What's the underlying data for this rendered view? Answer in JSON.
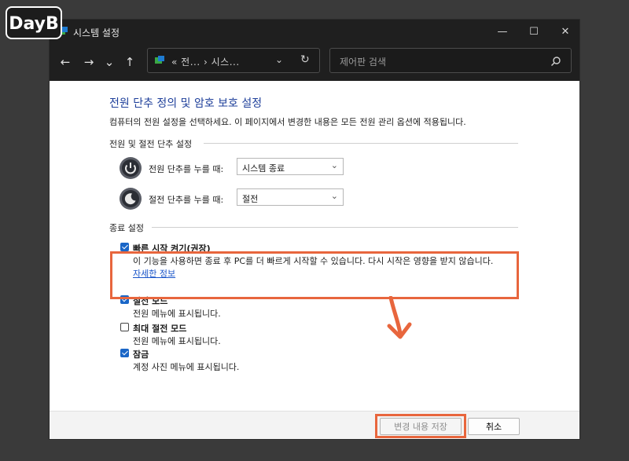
{
  "logo": {
    "text": "DayB"
  },
  "window": {
    "title": "시스템 설정",
    "controls": {
      "minimize": "—",
      "maximize": "☐",
      "close": "✕"
    }
  },
  "nav": {
    "back": "←",
    "forward": "→",
    "recent": "⌄",
    "up": "↑",
    "address": {
      "prefix": "«",
      "crumb1": "전...",
      "separator": "›",
      "crumb2": "시스...",
      "dropdown": "⌄",
      "refresh": "↻"
    },
    "search_placeholder": "제어판 검색"
  },
  "page": {
    "title": "전원 단추 정의 및 암호 보호 설정",
    "description": "컴퓨터의 전원 설정을 선택하세요. 이 페이지에서 변경한 내용은 모든 전원 관리 옵션에 적용됩니다."
  },
  "power_group": {
    "label": "전원 및 절전 단추 설정",
    "rows": [
      {
        "label": "전원 단추를 누를 때:",
        "value": "시스템 종료",
        "icon": "power-icon"
      },
      {
        "label": "절전 단추를 누를 때:",
        "value": "절전",
        "icon": "sleep-icon"
      }
    ]
  },
  "shutdown_group": {
    "label": "종료 설정",
    "items": [
      {
        "title": "빠른 시작 켜기(권장)",
        "desc": "이 기능을 사용하면 종료 후 PC를 더 빠르게 시작할 수 있습니다. 다시 시작은 영향을 받지 않습니다.",
        "link": "자세한 정보",
        "checked": true
      },
      {
        "title": "절전 모드",
        "desc": "전원 메뉴에 표시됩니다.",
        "checked": true
      },
      {
        "title": "최대 절전 모드",
        "desc": "전원 메뉴에 표시됩니다.",
        "checked": false
      },
      {
        "title": "잠금",
        "desc": "계정 사진 메뉴에 표시됩니다.",
        "checked": true
      }
    ]
  },
  "footer": {
    "save": "변경 내용 저장",
    "cancel": "취소"
  },
  "colors": {
    "accent": "#1a66c7",
    "highlight": "#e8663d",
    "title": "#1e3f9a"
  }
}
